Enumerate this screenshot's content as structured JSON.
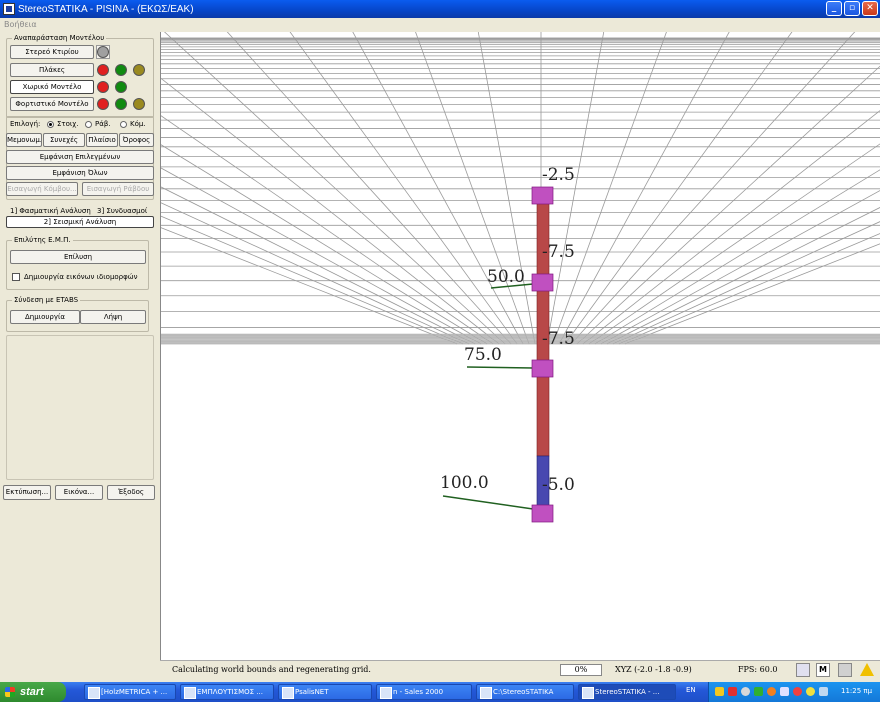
{
  "window": {
    "title": "StereoSTATIKA - PISINA - (ΕΚΩΣ/ΕΑΚ)"
  },
  "menu": {
    "help": "Βοήθεια"
  },
  "model_group": {
    "label": "Αναπαράσταση Μοντέλου",
    "buttons": [
      "Στερεό Κτιρίου",
      "Πλάκες",
      "Χωρικό Μοντέλο",
      "Φορτιστικό Μοντέλο"
    ]
  },
  "selection": {
    "label": "Επιλογή:",
    "radios": [
      "Στοιχ.",
      "Ράβ.",
      "Κόμ."
    ],
    "buttons": [
      "Μεμονωμ.",
      "Συνεχές",
      "Πλαίσιο",
      "Όροφος"
    ],
    "show_selected": "Εμφάνιση Επιλεγμένων",
    "show_all": "Εμφάνιση Όλων",
    "insert_node": "Εισαγωγή Κόμβου...",
    "insert_bar": "Εισαγωγή Ράβδου"
  },
  "tabs": [
    "1] Φασματική Ανάλυση",
    "3] Συνδυασμοί",
    "2] Σεισμική Ανάλυση"
  ],
  "solver": {
    "label": "Επιλύτης Ε.Μ.Π.",
    "solve": "Επίλυση",
    "checkbox": "Δημιουργία εικόνων ιδιομορφών"
  },
  "etabs": {
    "label": "Σύνδεση με ETABS",
    "create": "Δημιουργία",
    "receive": "Λήψη"
  },
  "bottom_buttons": [
    "Εκτύπωση...",
    "Εικόνα...",
    "Έξοδος"
  ],
  "viewport": {
    "node_labels": [
      "-2.5",
      "-7.5",
      "-7.5",
      "-5.0"
    ],
    "load_labels": [
      "50.0",
      "75.0",
      "100.0"
    ],
    "colors": {
      "column_red": "#b84848",
      "column_blue": "#4848b0",
      "node": "#c050c0",
      "arrow": "#206020"
    }
  },
  "status": {
    "message": "Calculating world bounds and regenerating grid.",
    "progress": "0%",
    "xyz": "XYZ (-2.0 -1.8 -0.9)",
    "fps": "FPS: 60.0"
  },
  "taskbar": {
    "start": "start",
    "tasks": [
      "[HolzMETRICA + ...",
      "ΕΜΠΛΟΥΤΙΣΜΟΣ ...",
      "PsalisNET",
      "n - Sales 2000",
      "C:\\StereoSTATIKA",
      "StereoSTATIKA - ..."
    ],
    "lang": "EN",
    "clock": "11:25 πμ"
  }
}
